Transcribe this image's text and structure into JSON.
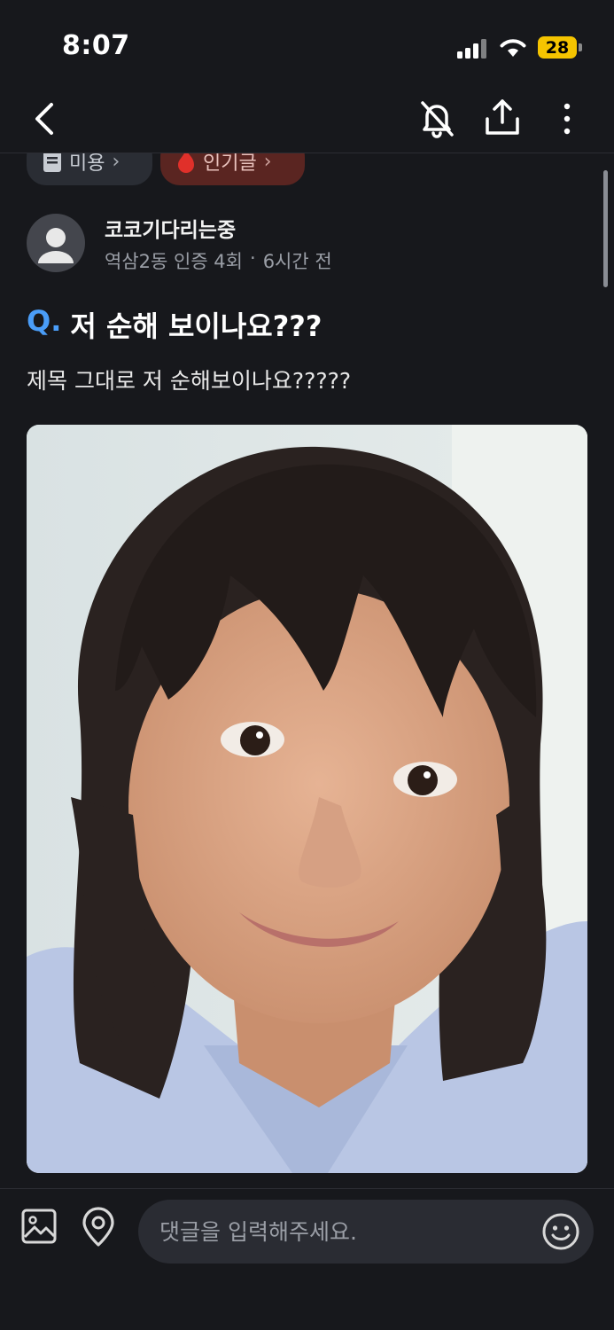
{
  "status_bar": {
    "time": "8:07",
    "battery_level": "28",
    "battery_color": "#f5c400"
  },
  "nav": {
    "back_icon": "chevron-left-icon",
    "bell_icon": "bell-off-icon",
    "share_icon": "share-icon",
    "more_icon": "more-vertical-icon"
  },
  "chips": [
    {
      "label": "미용",
      "icon": "document-icon"
    },
    {
      "label": "인기글",
      "icon": "fire-icon"
    }
  ],
  "author": {
    "name": "코코기다리는중",
    "location_badge": "역삼2동 인증 4회",
    "separator": "·",
    "time_ago": "6시간 전"
  },
  "post": {
    "q_prefix": "Q.",
    "title": "저 순해 보이나요???",
    "body": "제목 그대로 저 순해보이나요?????",
    "image_icon": "photo-selfie"
  },
  "comment_bar": {
    "image_icon": "image-icon",
    "location_icon": "location-pin-icon",
    "placeholder": "댓글을 입력해주세요.",
    "emoji_icon": "emoji-icon"
  },
  "colors": {
    "background": "#17181c",
    "accent_blue": "#4a9df8",
    "popular_chip_bg": "#5a2521",
    "input_bg": "#2a2c33"
  }
}
